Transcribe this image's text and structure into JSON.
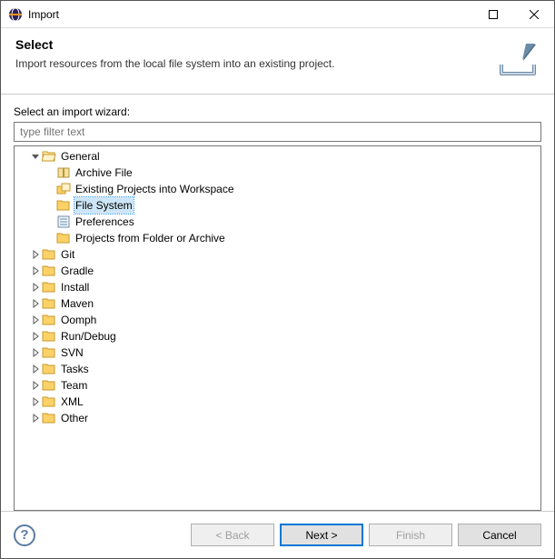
{
  "window": {
    "title": "Import"
  },
  "header": {
    "title": "Select",
    "description": "Import resources from the local file system into an existing project."
  },
  "body": {
    "label": "Select an import wizard:",
    "filter_placeholder": "type filter text"
  },
  "tree": [
    {
      "depth": 1,
      "twisty": "open",
      "icon": "folder-open",
      "label": "General",
      "selected": false
    },
    {
      "depth": 2,
      "twisty": "none",
      "icon": "archive",
      "label": "Archive File",
      "selected": false
    },
    {
      "depth": 2,
      "twisty": "none",
      "icon": "projects",
      "label": "Existing Projects into Workspace",
      "selected": false
    },
    {
      "depth": 2,
      "twisty": "none",
      "icon": "folder",
      "label": "File System",
      "selected": true
    },
    {
      "depth": 2,
      "twisty": "none",
      "icon": "prefs",
      "label": "Preferences",
      "selected": false
    },
    {
      "depth": 2,
      "twisty": "none",
      "icon": "folder",
      "label": "Projects from Folder or Archive",
      "selected": false
    },
    {
      "depth": 1,
      "twisty": "closed",
      "icon": "folder",
      "label": "Git",
      "selected": false
    },
    {
      "depth": 1,
      "twisty": "closed",
      "icon": "folder",
      "label": "Gradle",
      "selected": false
    },
    {
      "depth": 1,
      "twisty": "closed",
      "icon": "folder",
      "label": "Install",
      "selected": false
    },
    {
      "depth": 1,
      "twisty": "closed",
      "icon": "folder",
      "label": "Maven",
      "selected": false
    },
    {
      "depth": 1,
      "twisty": "closed",
      "icon": "folder",
      "label": "Oomph",
      "selected": false
    },
    {
      "depth": 1,
      "twisty": "closed",
      "icon": "folder",
      "label": "Run/Debug",
      "selected": false
    },
    {
      "depth": 1,
      "twisty": "closed",
      "icon": "folder",
      "label": "SVN",
      "selected": false
    },
    {
      "depth": 1,
      "twisty": "closed",
      "icon": "folder",
      "label": "Tasks",
      "selected": false
    },
    {
      "depth": 1,
      "twisty": "closed",
      "icon": "folder",
      "label": "Team",
      "selected": false
    },
    {
      "depth": 1,
      "twisty": "closed",
      "icon": "folder",
      "label": "XML",
      "selected": false
    },
    {
      "depth": 1,
      "twisty": "closed",
      "icon": "folder",
      "label": "Other",
      "selected": false
    }
  ],
  "footer": {
    "back": "< Back",
    "next": "Next >",
    "finish": "Finish",
    "cancel": "Cancel"
  }
}
